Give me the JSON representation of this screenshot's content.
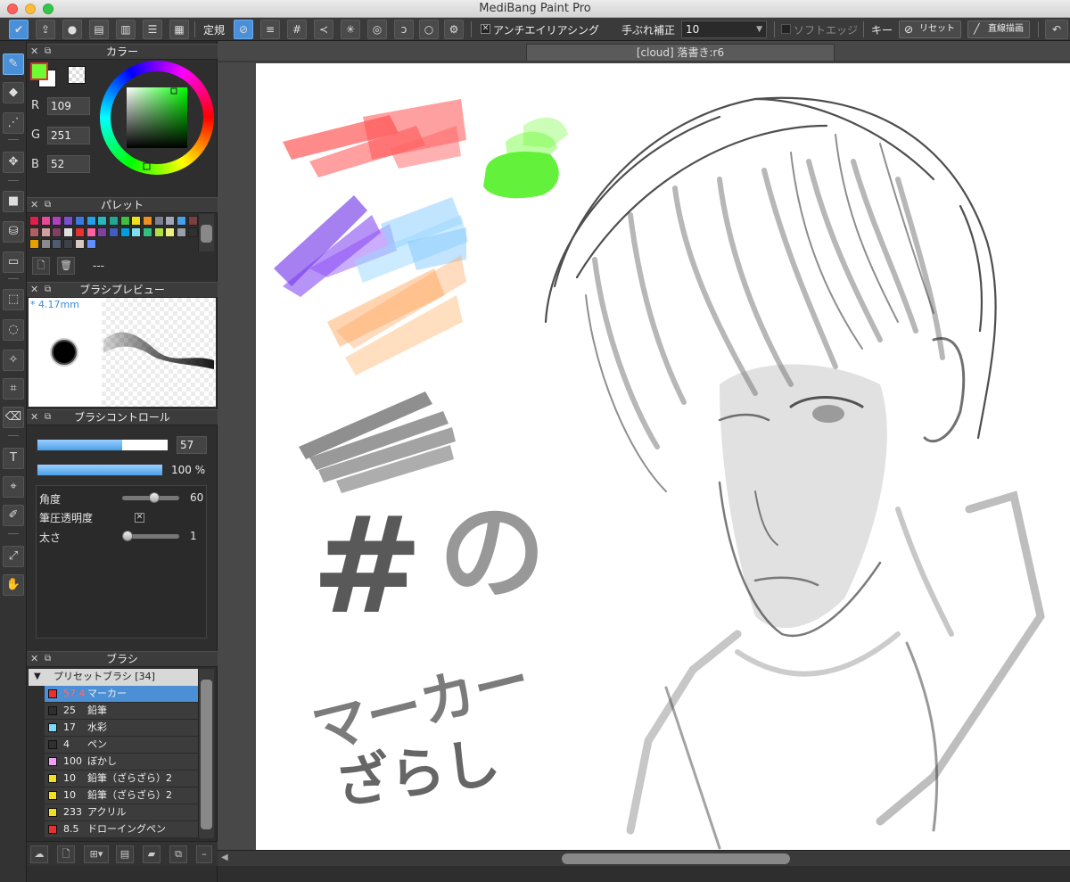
{
  "window": {
    "title": "MediBang Paint Pro"
  },
  "toolbar": {
    "ruler_label": "定規",
    "antialias_label": "アンチエイリアシング",
    "stabilizer_label": "手ぶれ補正",
    "stabilizer_value": "10",
    "soft_edge_label": "ソフトエッジ",
    "key_label": "キー",
    "reset_label": "リセット",
    "straight_line_label": "直線描画"
  },
  "color_panel": {
    "title": "カラー",
    "r_label": "R",
    "r_value": "109",
    "g_label": "G",
    "g_value": "251",
    "b_label": "B",
    "b_value": "52",
    "foreground": "#6dfb34",
    "background": "#ffffff"
  },
  "palette_panel": {
    "title": "パレット",
    "name": "---",
    "colors": [
      "#e0204c",
      "#e84a9a",
      "#b040c0",
      "#7a50d0",
      "#3a7ae0",
      "#26a0e8",
      "#24b8c0",
      "#20a890",
      "#40c040",
      "#f0e020",
      "#f09020",
      "#7a8090",
      "#a0a8b8",
      "#4aa0e8",
      "#7a4040",
      "#b06060",
      "#d0a0a0",
      "#804060",
      "#e0e0e0",
      "#e83030",
      "#ff60a0",
      "#8040a0",
      "#4060c0",
      "#00a0e0",
      "#80e0f0",
      "#30c080",
      "#b0e040",
      "#f0f080",
      "#9aa0a8",
      "#303030",
      "#e8a000",
      "#8a8a8a",
      "#505a70",
      "#404048",
      "#d8c8c0",
      "#6090ff"
    ]
  },
  "brush_preview_panel": {
    "title": "ブラシプレビュー",
    "size_label": "* 4.17mm"
  },
  "brush_control_panel": {
    "title": "ブラシコントロール",
    "size_value": "57",
    "size_fraction": 0.65,
    "opacity_value": "100 %",
    "opacity_fraction": 1.0,
    "angle_label": "角度",
    "angle_value": "60",
    "angle_fraction": 0.6,
    "pressure_opacity_label": "筆圧透明度",
    "thickness_label": "太さ",
    "thickness_value": "1",
    "thickness_fraction": 0.0
  },
  "brush_panel": {
    "title": "ブラシ",
    "group_label": "プリセットブラシ [34]",
    "items": [
      {
        "size": "57.4",
        "name": "マーカー",
        "color": "#e83030",
        "selected": true
      },
      {
        "size": "25",
        "name": "鉛筆",
        "color": "#303030",
        "selected": false
      },
      {
        "size": "17",
        "name": "水彩",
        "color": "#80d8f8",
        "selected": false
      },
      {
        "size": "4",
        "name": "ペン",
        "color": "#303030",
        "selected": false
      },
      {
        "size": "100",
        "name": "ぼかし",
        "color": "#f0a0f0",
        "selected": false
      },
      {
        "size": "10",
        "name": "鉛筆（ざらざら）2",
        "color": "#f0e020",
        "selected": false
      },
      {
        "size": "10",
        "name": "鉛筆（ざらざら）2",
        "color": "#f0e020",
        "selected": false
      },
      {
        "size": "233",
        "name": "アクリル",
        "color": "#f0e020",
        "selected": false
      },
      {
        "size": "8.5",
        "name": "ドローイングペン",
        "color": "#e83030",
        "selected": false
      }
    ]
  },
  "document": {
    "tab_title": "[cloud] 落書き:r6",
    "canvas_text": {
      "line1": "マーカー",
      "line2": "ざらし",
      "char_no": "の",
      "char_hash": "#"
    }
  }
}
